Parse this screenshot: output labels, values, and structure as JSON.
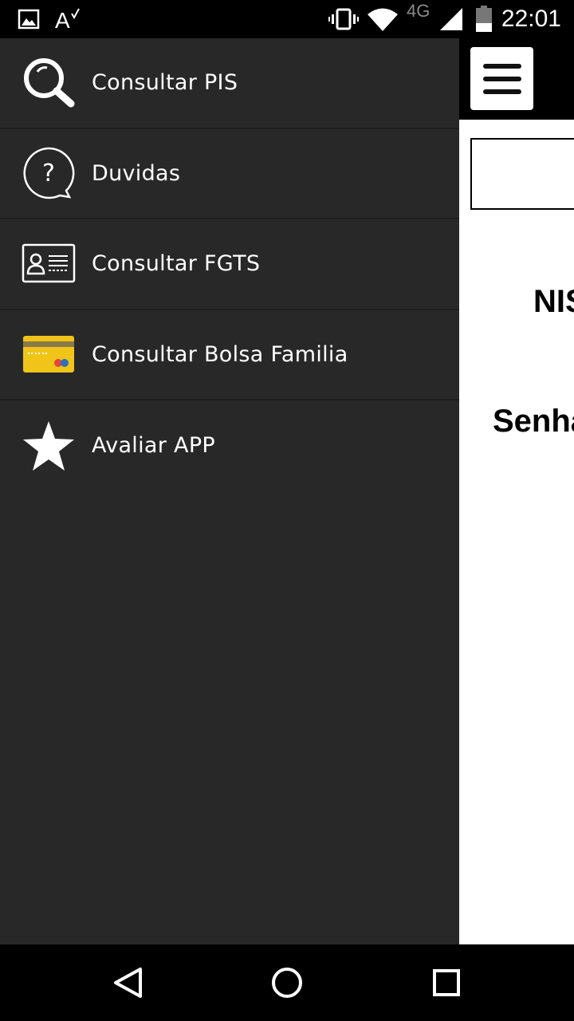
{
  "status_bar": {
    "time": "22:01",
    "network": "4G",
    "icons": [
      "image-notification-icon",
      "spellcheck-icon",
      "vibrate-icon",
      "wifi-icon",
      "signal-icon",
      "battery-icon"
    ]
  },
  "drawer": {
    "items": [
      {
        "label": "Consultar PIS",
        "icon": "search-icon"
      },
      {
        "label": "Duvidas",
        "icon": "help-icon"
      },
      {
        "label": "Consultar FGTS",
        "icon": "id-card-icon"
      },
      {
        "label": "Consultar Bolsa Familia",
        "icon": "credit-card-icon"
      },
      {
        "label": "Avaliar APP",
        "icon": "star-icon"
      }
    ]
  },
  "content": {
    "nis_label": "NIS",
    "senha_label": "Senha"
  },
  "nav_bar": {
    "buttons": [
      "back-icon",
      "home-icon",
      "recents-icon"
    ]
  },
  "colors": {
    "drawer_bg": "#282828",
    "card_yellow": "#f0c419",
    "card_stripe": "#8a7a4a"
  }
}
